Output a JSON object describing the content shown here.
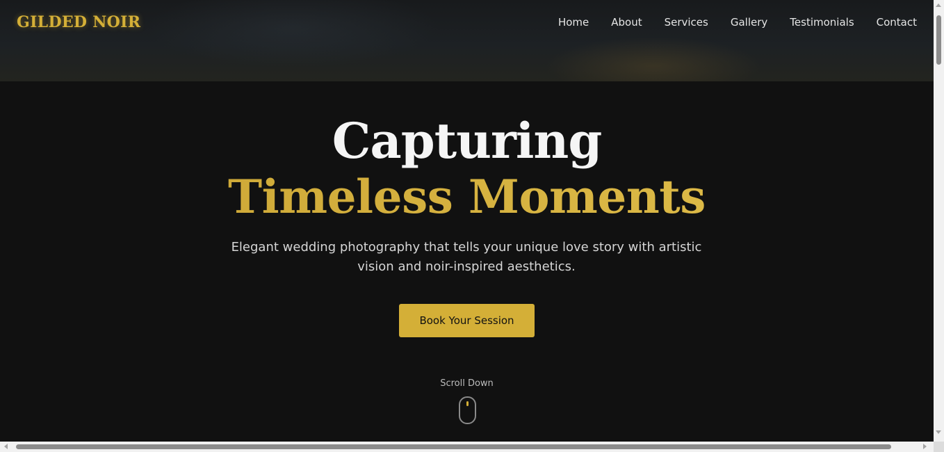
{
  "brand": {
    "logo_text": "GILDED NOIR",
    "accent_color": "#d4af37",
    "background_color": "#111111"
  },
  "nav": {
    "items": [
      {
        "label": "Home"
      },
      {
        "label": "About"
      },
      {
        "label": "Services"
      },
      {
        "label": "Gallery"
      },
      {
        "label": "Testimonials"
      },
      {
        "label": "Contact"
      }
    ]
  },
  "hero": {
    "title_line1": "Capturing",
    "title_line2": "Timeless Moments",
    "subtitle": "Elegant wedding photography that tells your unique love story with artistic vision and noir-inspired aesthetics.",
    "cta_label": "Book Your Session",
    "scroll_label": "Scroll Down",
    "scroll_icon": "mouse-icon"
  }
}
